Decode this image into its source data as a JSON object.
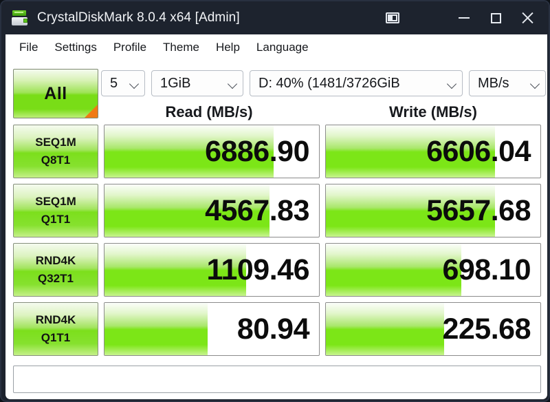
{
  "window": {
    "title": "CrystalDiskMark 8.0.4 x64 [Admin]",
    "app_icon": "disk-drive-icon",
    "buttons": {
      "copy": "copy-icon",
      "minimize": "minimize-icon",
      "maximize": "maximize-icon",
      "close": "close-icon"
    }
  },
  "menubar": {
    "items": [
      {
        "label": "File"
      },
      {
        "label": "Settings"
      },
      {
        "label": "Profile"
      },
      {
        "label": "Theme"
      },
      {
        "label": "Help"
      },
      {
        "label": "Language"
      }
    ]
  },
  "toolbar": {
    "all_button_label": "All",
    "test_count": "5",
    "test_size": "1GiB",
    "drive": "D: 40% (1481/3726GiB",
    "unit": "MB/s"
  },
  "columns": {
    "read": "Read (MB/s)",
    "write": "Write (MB/s)"
  },
  "comment": "",
  "chart_data": {
    "type": "bar",
    "title": "CrystalDiskMark 8.0.4 x64 benchmark results",
    "unit": "MB/s",
    "categories": [
      "SEQ1M Q8T1",
      "SEQ1M Q1T1",
      "RND4K Q32T1",
      "RND4K Q1T1"
    ],
    "series": [
      {
        "name": "Read (MB/s)",
        "values": [
          6886.9,
          4567.83,
          1109.46,
          80.94
        ]
      },
      {
        "name": "Write (MB/s)",
        "values": [
          6606.04,
          5657.68,
          698.1,
          225.68
        ]
      }
    ],
    "legend": "columns",
    "grid": false,
    "rows": [
      {
        "line1": "SEQ1M",
        "line2": "Q8T1",
        "read_value": "6886.90",
        "read_pct": 79,
        "write_value": "6606.04",
        "write_pct": 79
      },
      {
        "line1": "SEQ1M",
        "line2": "Q1T1",
        "read_value": "4567.83",
        "read_pct": 77,
        "write_value": "5657.68",
        "write_pct": 79
      },
      {
        "line1": "RND4K",
        "line2": "Q32T1",
        "read_value": "1109.46",
        "read_pct": 66,
        "write_value": "698.10",
        "write_pct": 63
      },
      {
        "line1": "RND4K",
        "line2": "Q1T1",
        "read_value": "80.94",
        "read_pct": 48,
        "write_value": "225.68",
        "write_pct": 55
      }
    ]
  },
  "colors": {
    "titlebar": "#1d232e",
    "bar_green": "#7ce617",
    "accent_orange": "#f07a14"
  }
}
